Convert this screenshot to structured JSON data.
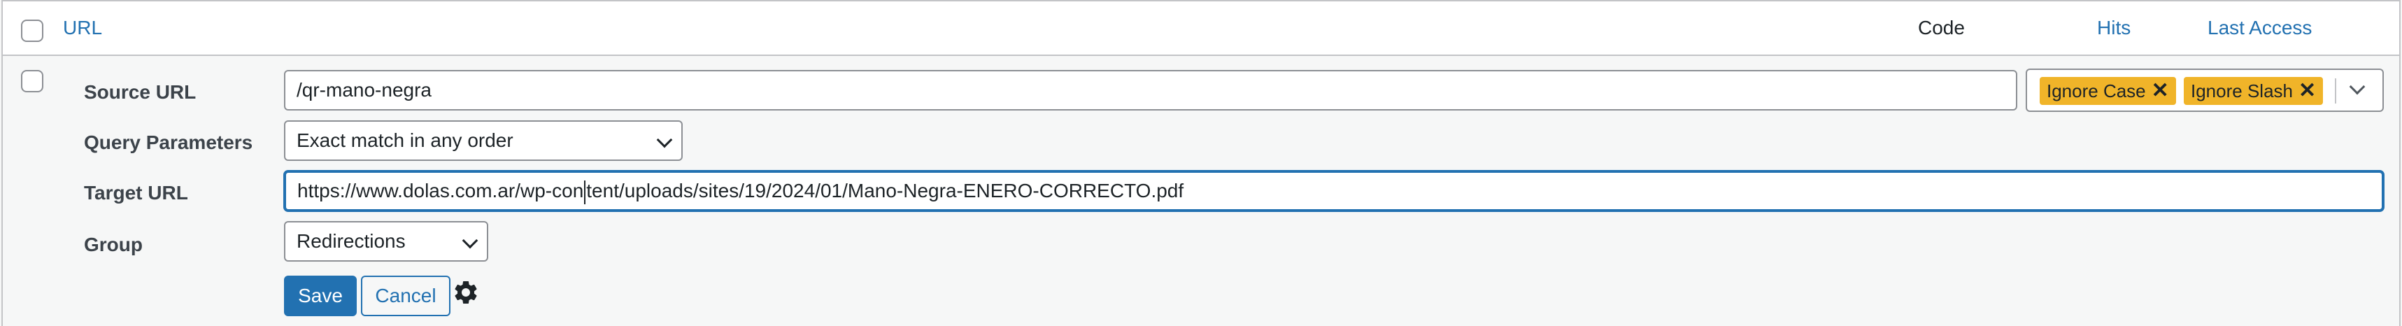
{
  "header": {
    "url_label": "URL",
    "code_label": "Code",
    "hits_label": "Hits",
    "last_access_label": "Last Access"
  },
  "form": {
    "source_url": {
      "label": "Source URL",
      "value": "/qr-mano-negra"
    },
    "flags": [
      {
        "label": "Ignore Case",
        "remove_icon": "close-icon"
      },
      {
        "label": "Ignore Slash",
        "remove_icon": "close-icon"
      }
    ],
    "query_parameters": {
      "label": "Query Parameters",
      "selected": "Exact match in any order"
    },
    "target_url": {
      "label": "Target URL",
      "value_before_caret": "https://www.dolas.com.ar/wp-con",
      "value_after_caret": "tent/uploads/sites/19/2024/01/Mano-Negra-ENERO-CORRECTO.pdf"
    },
    "group": {
      "label": "Group",
      "selected": "Redirections"
    },
    "save_label": "Save",
    "cancel_label": "Cancel",
    "settings_icon": "gear-icon"
  },
  "colors": {
    "accent": "#2271b1",
    "flag_bg": "#f0b429",
    "border": "#8c8f94",
    "row_bg": "#f6f7f7"
  }
}
